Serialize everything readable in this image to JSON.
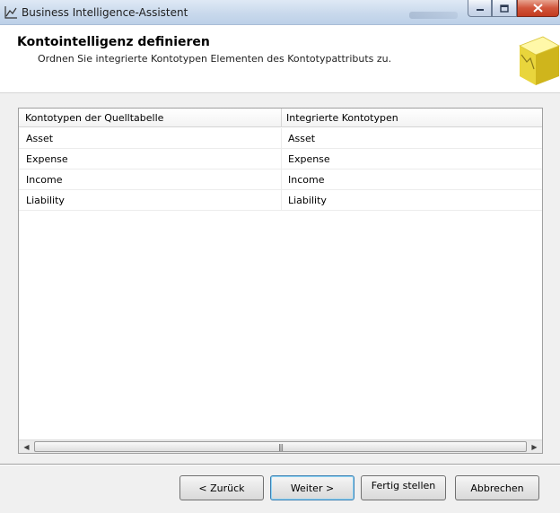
{
  "window": {
    "title": "Business Intelligence-Assistent"
  },
  "header": {
    "title": "Kontointelligenz definieren",
    "subtitle": "Ordnen Sie integrierte Kontotypen Elementen des Kontotypattributs zu."
  },
  "grid": {
    "columns": [
      "Kontotypen der Quelltabelle",
      "Integrierte Kontotypen"
    ],
    "rows": [
      [
        "Asset",
        "Asset"
      ],
      [
        "Expense",
        "Expense"
      ],
      [
        "Income",
        "Income"
      ],
      [
        "Liability",
        "Liability"
      ]
    ]
  },
  "buttons": {
    "back": "< Zurück",
    "next": "Weiter >",
    "finish": "Fertig stellen",
    "cancel": "Abbrechen"
  },
  "colors": {
    "default_button_border": "#3c7fb1",
    "close_button": "#c33a1f"
  }
}
